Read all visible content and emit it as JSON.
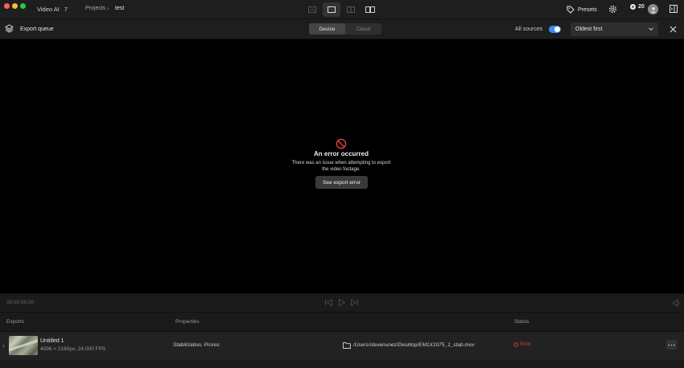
{
  "titlebar": {
    "app_name": "Video AI",
    "app_version": "7",
    "breadcrumb": {
      "projects": "Projects",
      "current": "test"
    },
    "presets_label": "Presets",
    "credits": "20"
  },
  "toolbar": {
    "queue_label": "Export queue",
    "targets": {
      "device": "Device",
      "cloud": "Cloud",
      "selected": "Device"
    },
    "all_sources_label": "All sources",
    "all_sources_on": true,
    "sort": {
      "selected": "Oldest first"
    }
  },
  "preview": {
    "error_title": "An error occurred",
    "error_message": "There was an issue when attempting to export the video footage.",
    "error_button": "See export error"
  },
  "player": {
    "timecode": "00:00:00:00"
  },
  "exports": {
    "columns": {
      "exports": "Exports",
      "properties": "Properties",
      "status": "Status"
    },
    "rows": [
      {
        "title": "Untitled 1",
        "meta": "4096 × 2160px, 24.000 FPS",
        "properties": "Stabilization, Prores",
        "path": "/Users/stevenunez/Desktop/EM1X1075_1_stab.mov",
        "status": "Error"
      }
    ]
  },
  "colors": {
    "accent": "#3b8cf3",
    "error": "#e0453a",
    "background": "#000000",
    "chrome": "#1e1e1e"
  },
  "icons": [
    "layers-icon",
    "presets-tag-icon",
    "gear-icon",
    "credit-icon",
    "avatar-icon",
    "panel-toggle-icon",
    "close-icon",
    "error-circle-icon",
    "folder-icon",
    "skip-back-icon",
    "play-icon",
    "skip-forward-icon",
    "volume-icon"
  ]
}
